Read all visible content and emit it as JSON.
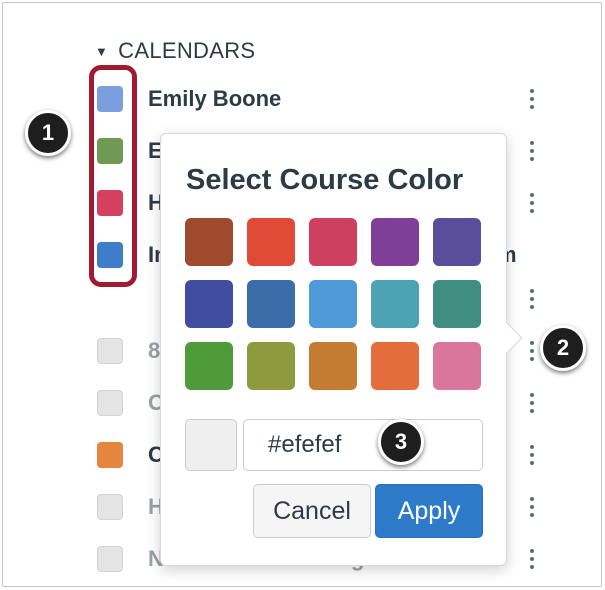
{
  "calendars": {
    "header": "CALENDARS",
    "rows": [
      {
        "name": "Emily Boone",
        "color": "#7a9ee0"
      },
      {
        "name": "E",
        "color": "#6e9a53"
      },
      {
        "name": "H",
        "color": "#d4405e"
      },
      {
        "name": "In",
        "trailing_text": "m",
        "color": "#3e7dc9"
      },
      {
        "name": "8",
        "color": ""
      },
      {
        "name": "C",
        "color": ""
      },
      {
        "name": "C",
        "color": "#e6853e"
      },
      {
        "name": "H",
        "color": ""
      },
      {
        "name": "Notifications for Beginners",
        "color": ""
      }
    ]
  },
  "popover": {
    "title": "Select Course Color",
    "colors": [
      "#a04a2d",
      "#e04b38",
      "#ce4060",
      "#7f3f98",
      "#5a4e9b",
      "#3f4ea0",
      "#3b6ea8",
      "#4e9ad8",
      "#4ba3b4",
      "#3f8e80",
      "#4f9a3a",
      "#8e9a3e",
      "#c47c33",
      "#e36e3c",
      "#d9769a"
    ],
    "preview_color": "#efefef",
    "hex_value": "#efefef",
    "cancel_label": "Cancel",
    "apply_label": "Apply"
  },
  "callouts": [
    "1",
    "2",
    "3"
  ]
}
